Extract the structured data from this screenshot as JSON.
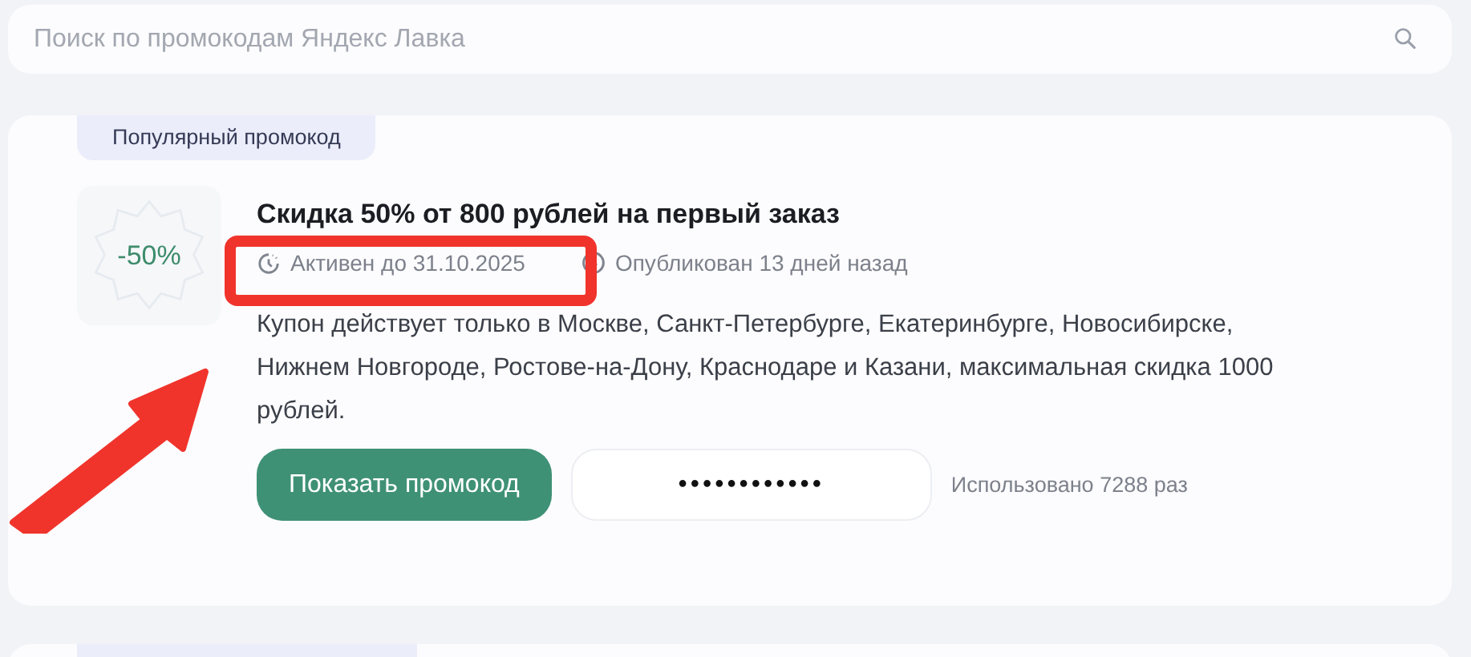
{
  "search": {
    "placeholder": "Поиск по промокодам Яндекс Лавка"
  },
  "promos": [
    {
      "badge": "Популярный промокод",
      "discount": "-50%",
      "title": "Скидка 50% от 800 рублей на первый заказ",
      "active_until": "Активен до 31.10.2025",
      "published": "Опубликован 13 дней назад",
      "description": "Купон действует только в Москве, Санкт-Петербурге, Екатеринбурге, Новосибирске, Нижнем Новгороде, Ростове-на-Дону, Краснодаре и Казани, максимальная скидка 1000 рублей.",
      "show_button": "Показать промокод",
      "code_mask": "••••••••••••",
      "used": "Использовано 7288 раз"
    }
  ],
  "annotations": {
    "highlight_box": true,
    "arrow": true
  }
}
